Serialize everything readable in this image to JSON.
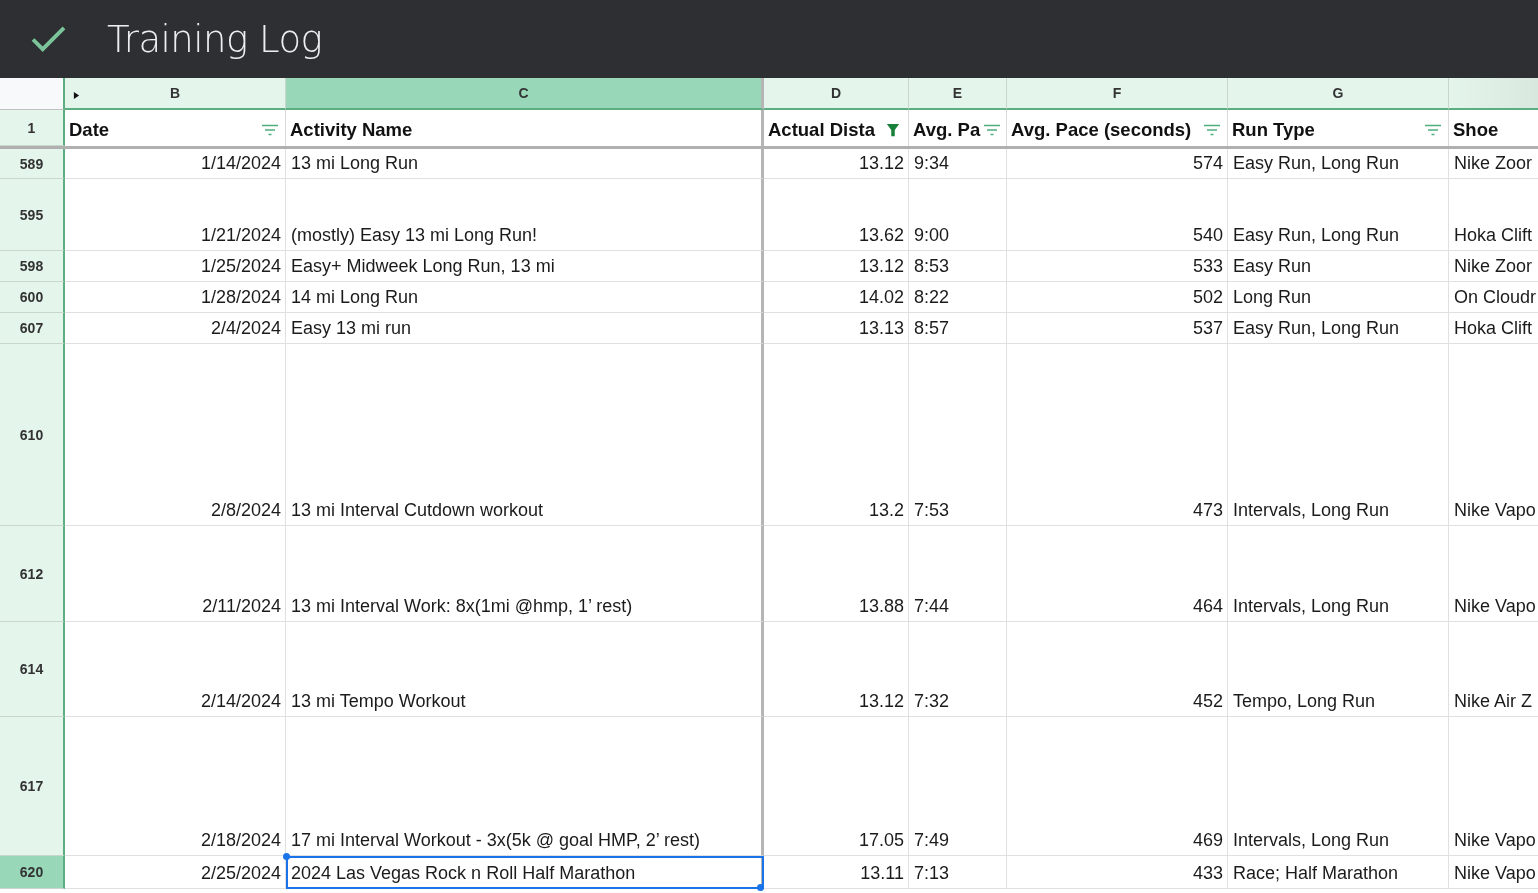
{
  "app": {
    "title": "Training Log",
    "saved": true
  },
  "columns": [
    {
      "letter": "B",
      "kind": "date",
      "selected": false,
      "header": {
        "text": "Date",
        "filter": true,
        "filter_active": false
      }
    },
    {
      "letter": "C",
      "kind": "text",
      "selected": true,
      "header": {
        "text": "Activity Name"
      }
    },
    {
      "letter": "D",
      "kind": "number",
      "selected": false,
      "header": {
        "text": "Actual Dista",
        "filter": true,
        "filter_active": true
      }
    },
    {
      "letter": "E",
      "kind": "text",
      "selected": false,
      "header": {
        "text": "Avg. Pa",
        "filter": true,
        "filter_active": false
      }
    },
    {
      "letter": "F",
      "kind": "number",
      "selected": false,
      "header": {
        "text": "Avg. Pace (seconds)",
        "filter": true,
        "filter_active": false
      }
    },
    {
      "letter": "G",
      "kind": "text",
      "selected": false,
      "header": {
        "text": "Run Type",
        "filter": true,
        "filter_active": false
      }
    },
    {
      "kind": "text",
      "selected": false,
      "header": {
        "text": "Shoe"
      }
    }
  ],
  "header_row": {
    "number": "1"
  },
  "rows": [
    {
      "number": "589",
      "selected": false,
      "cells": [
        "1/14/2024",
        "13 mi Long Run",
        "13.12",
        "9:34",
        "574",
        "Easy Run, Long Run",
        "Nike Zoor"
      ]
    },
    {
      "number": "595",
      "selected": false,
      "cells": [
        "1/21/2024",
        "(mostly) Easy 13 mi Long Run!",
        "13.62",
        "9:00",
        "540",
        "Easy Run, Long Run",
        "Hoka Clift"
      ]
    },
    {
      "number": "598",
      "selected": false,
      "cells": [
        "1/25/2024",
        "Easy+ Midweek Long Run, 13 mi",
        "13.12",
        "8:53",
        "533",
        "Easy Run",
        "Nike Zoor"
      ]
    },
    {
      "number": "600",
      "selected": false,
      "cells": [
        "1/28/2024",
        "14 mi Long Run",
        "14.02",
        "8:22",
        "502",
        "Long Run",
        "On Cloudr"
      ]
    },
    {
      "number": "607",
      "selected": false,
      "cells": [
        "2/4/2024",
        "Easy 13 mi run",
        "13.13",
        "8:57",
        "537",
        "Easy Run, Long Run",
        "Hoka Clift"
      ]
    },
    {
      "number": "610",
      "selected": false,
      "cells": [
        "2/8/2024",
        "13 mi Interval Cutdown workout",
        "13.2",
        "7:53",
        "473",
        "Intervals, Long Run",
        "Nike Vapo"
      ]
    },
    {
      "number": "612",
      "selected": false,
      "cells": [
        "2/11/2024",
        "13 mi Interval Work: 8x(1mi @hmp, 1’ rest)",
        "13.88",
        "7:44",
        "464",
        "Intervals, Long Run",
        "Nike Vapo"
      ]
    },
    {
      "number": "614",
      "selected": false,
      "cells": [
        "2/14/2024",
        "13 mi Tempo Workout",
        "13.12",
        "7:32",
        "452",
        "Tempo, Long Run",
        "Nike Air Z"
      ]
    },
    {
      "number": "617",
      "selected": false,
      "cells": [
        "2/18/2024",
        "17 mi Interval Workout - 3x(5k @ goal HMP, 2’ rest)",
        "17.05",
        "7:49",
        "469",
        "Intervals, Long Run",
        "Nike Vapo"
      ]
    },
    {
      "number": "620",
      "selected": true,
      "cells": [
        "2/25/2024",
        "2024 Las Vegas Rock n Roll Half Marathon",
        "13.11",
        "7:13",
        "433",
        "Race; Half Marathon",
        "Nike Vapo"
      ]
    }
  ]
}
